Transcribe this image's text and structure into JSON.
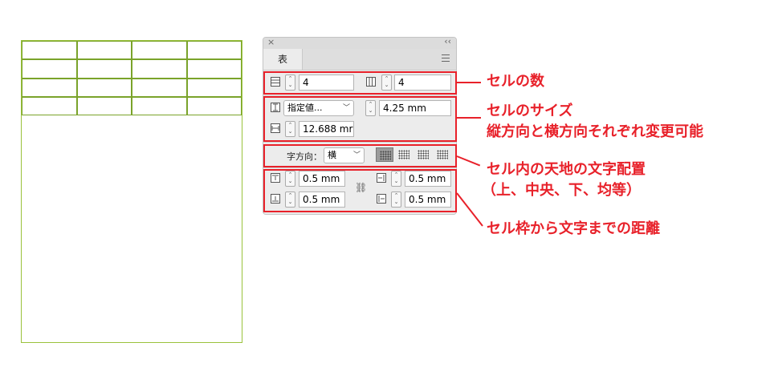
{
  "panel": {
    "tab_label": "表",
    "rows_value": "4",
    "cols_value": "4",
    "height_mode": "指定値...",
    "row_height": "4.25 mm",
    "col_width": "12.688 mr",
    "direction_label": "字方向：",
    "direction_value": "横",
    "inset_top": "0.5 mm",
    "inset_bottom": "0.5 mm",
    "inset_left": "0.5 mm",
    "inset_right": "0.5 mm"
  },
  "callouts": {
    "cell_count": "セルの数",
    "cell_size_line1": "セルのサイズ",
    "cell_size_line2": "縦方向と横方向それぞれ変更可能",
    "alignment_line1": "セル内の天地の文字配置",
    "alignment_line2": "（上、中央、下、均等）",
    "inset": "セル枠から文字までの距離"
  },
  "colors": {
    "accent_red": "#e8212a",
    "table_green": "#9ac23c"
  }
}
